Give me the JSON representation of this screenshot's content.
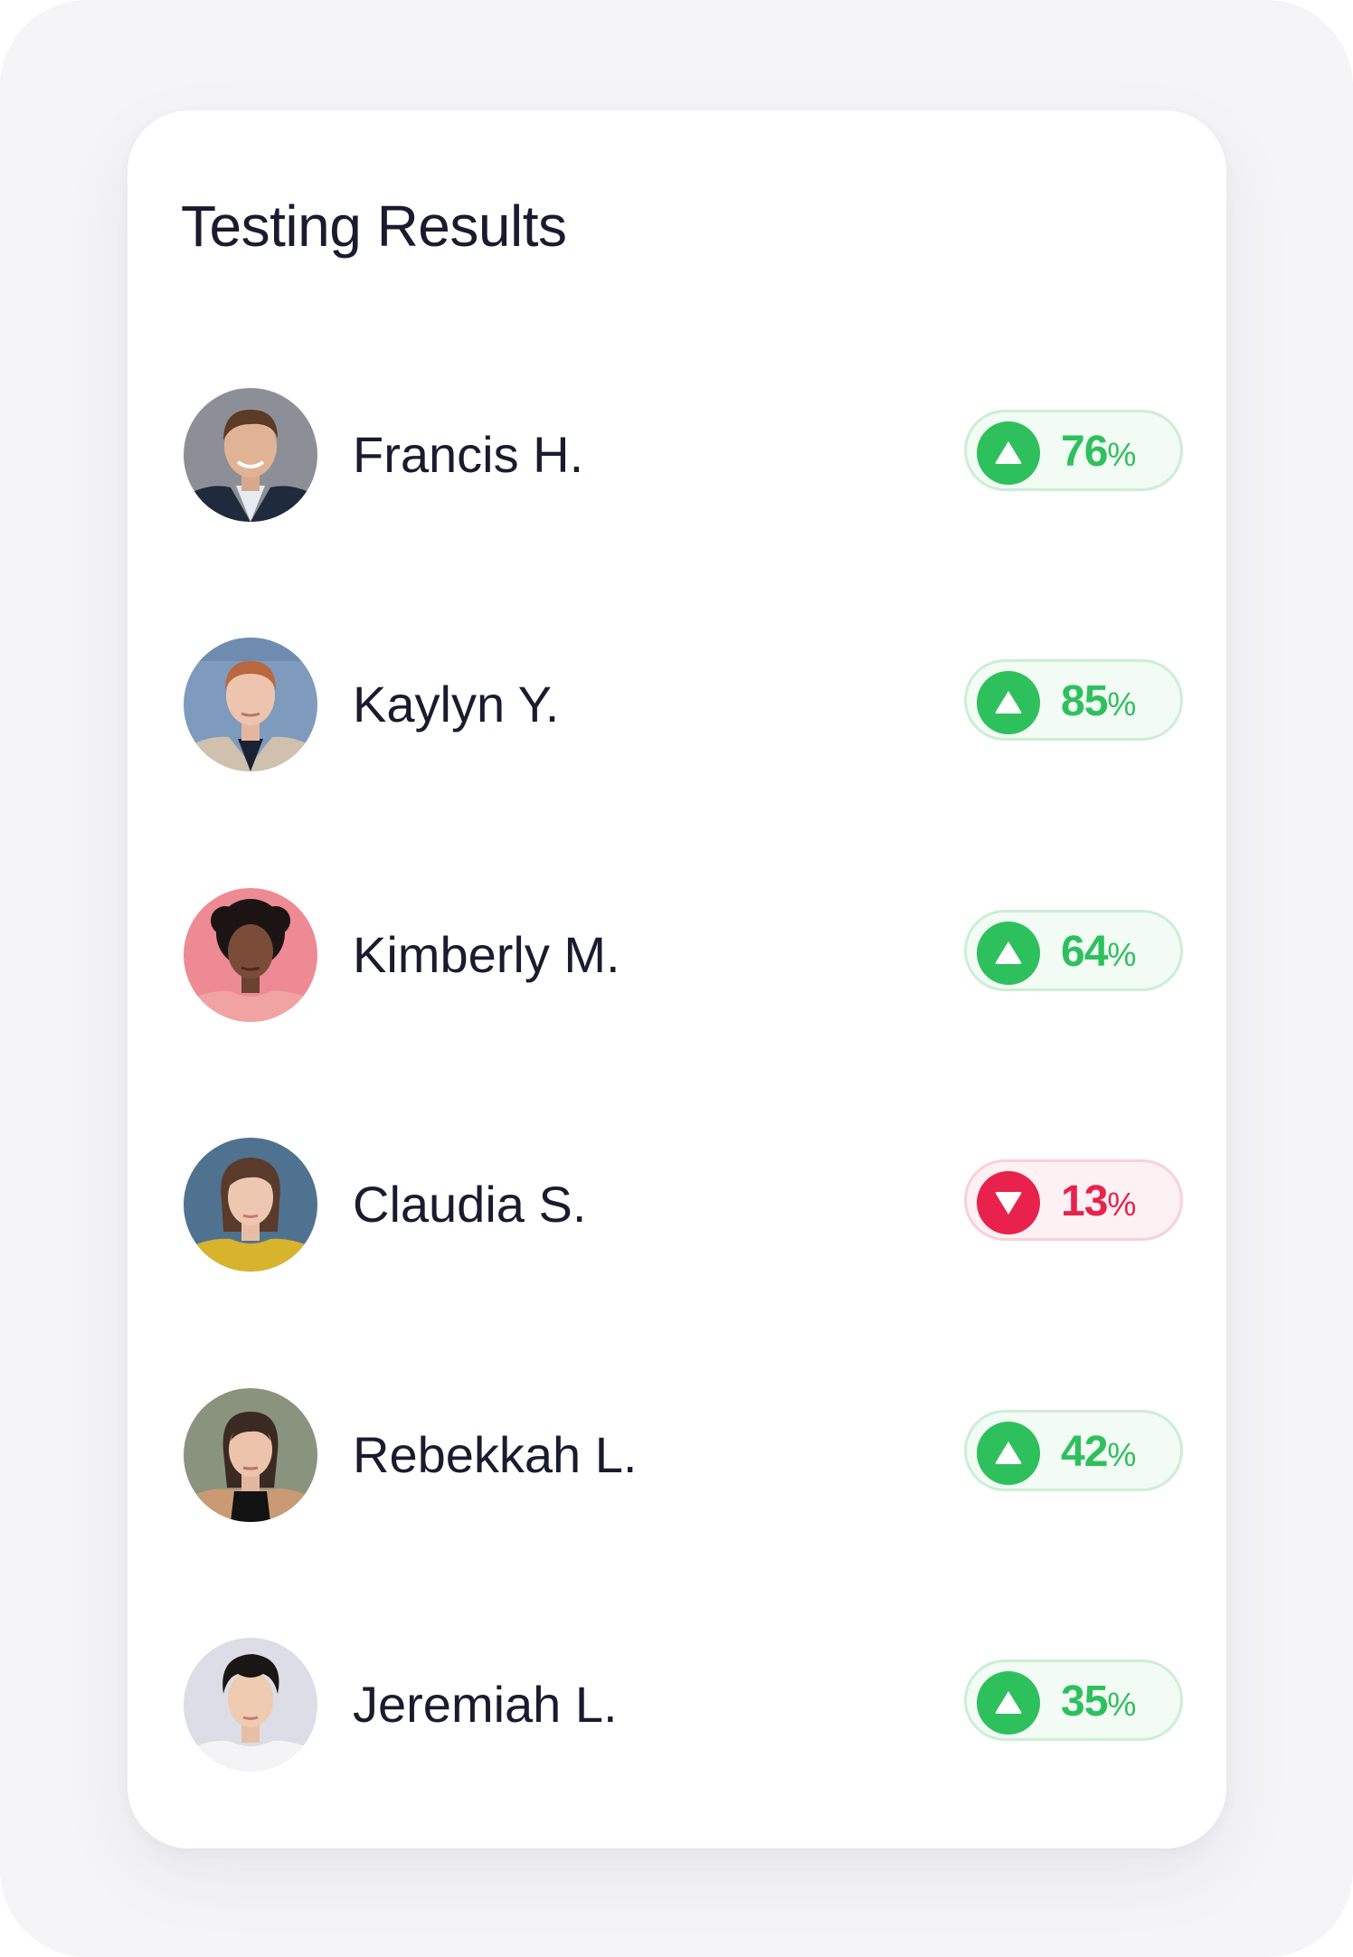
{
  "card": {
    "title": "Testing Results"
  },
  "colors": {
    "positive": "#2fc05e",
    "negative": "#e8214d",
    "text": "#1a1b2e",
    "background": "#f5f5f8"
  },
  "results": [
    {
      "name": "Francis H.",
      "value": "76",
      "unit": "%",
      "trend": "up",
      "trend_icon": "triangle-up-icon"
    },
    {
      "name": "Kaylyn Y.",
      "value": "85",
      "unit": "%",
      "trend": "up",
      "trend_icon": "triangle-up-icon"
    },
    {
      "name": "Kimberly M.",
      "value": "64",
      "unit": "%",
      "trend": "up",
      "trend_icon": "triangle-up-icon"
    },
    {
      "name": "Claudia S.",
      "value": "13",
      "unit": "%",
      "trend": "down",
      "trend_icon": "triangle-down-icon"
    },
    {
      "name": "Rebekkah L.",
      "value": "42",
      "unit": "%",
      "trend": "up",
      "trend_icon": "triangle-up-icon"
    },
    {
      "name": "Jeremiah L.",
      "value": "35",
      "unit": "%",
      "trend": "up",
      "trend_icon": "triangle-up-icon"
    }
  ]
}
